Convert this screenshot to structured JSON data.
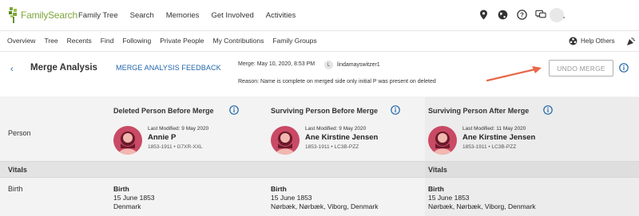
{
  "brand": {
    "name": "FamilySearch",
    "color": "#7da63b"
  },
  "topnav": {
    "items": [
      "Family Tree",
      "Search",
      "Memories",
      "Get Involved",
      "Activities"
    ],
    "icons": [
      "location-pin-icon",
      "globe-icon",
      "help-icon",
      "chat-icon",
      "bell-icon"
    ]
  },
  "subnav": {
    "items": [
      "Overview",
      "Tree",
      "Recents",
      "Find",
      "Following",
      "Private People",
      "My Contributions",
      "Family Groups"
    ],
    "help_others": "Help Others"
  },
  "header": {
    "back": "‹",
    "title": "Merge Analysis",
    "feedback": "MERGE ANALYSIS FEEDBACK",
    "merge_date": "Merge: May 10, 2020, 8:53 PM",
    "user_initial": "L",
    "username": "lindamayswitzer1",
    "reason": "Reason: Name is complete on merged side only initial P was present on deleted",
    "undo_label": "UNDO MERGE"
  },
  "columns": [
    {
      "heading": "Deleted Person Before Merge",
      "last_modified": "Last Modified: 9 May 2020",
      "name": "Annie P",
      "id": "1853-1911 • G7XR-XXL",
      "birth_label": "Birth",
      "birth_date": "15 June 1853",
      "birth_place": "Denmark"
    },
    {
      "heading": "Surviving Person Before Merge",
      "last_modified": "Last Modified: 9 May 2020",
      "name": "Ane Kirstine Jensen",
      "id": "1853-1911 • LC3B-PZZ",
      "birth_label": "Birth",
      "birth_date": "15 June 1853",
      "birth_place": "Nørbæk, Nørbæk, Viborg, Denmark"
    },
    {
      "heading": "Surviving Person After Merge",
      "last_modified": "Last Modified: 11 May 2020",
      "name": "Ane Kirstine Jensen",
      "id": "1853-1911 • LC3B-PZZ",
      "birth_label": "Birth",
      "birth_date": "15 June 1853",
      "birth_place": "Nørbæk, Nørbæk, Viborg, Denmark"
    }
  ],
  "rows": {
    "person": "Person",
    "vitals": "Vitals",
    "vitals_right": "Vitals",
    "birth": "Birth"
  },
  "colors": {
    "link": "#2266aa",
    "portrait": "#c94a65",
    "arrow": "#e8684a"
  }
}
